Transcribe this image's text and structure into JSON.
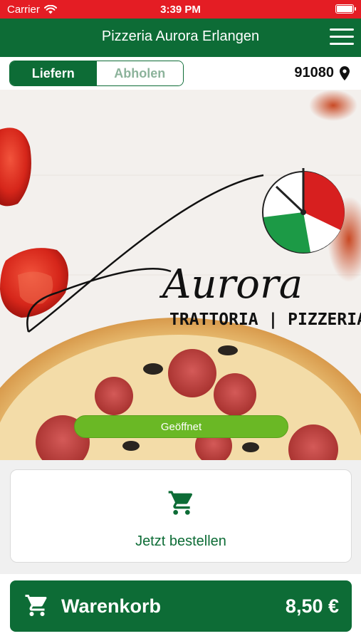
{
  "status_bar": {
    "carrier": "Carrier",
    "time": "3:39 PM",
    "battery_level": 1.0
  },
  "nav": {
    "title": "Pizzeria Aurora Erlangen",
    "menu_icon": "hamburger-menu-icon"
  },
  "order_mode": {
    "options": [
      "Liefern",
      "Abholen"
    ],
    "selected": "Liefern"
  },
  "location": {
    "zip": "91080",
    "icon": "location-pin-icon"
  },
  "hero": {
    "logo_script": "Aurora",
    "logo_tagline": "TRATTORIA | PIZZERIA",
    "status_badge": "Geöffnet"
  },
  "order_card": {
    "label": "Jetzt bestellen",
    "icon": "cart-icon"
  },
  "cart": {
    "label": "Warenkorb",
    "total": "8,50 €",
    "icon": "cart-icon"
  },
  "colors": {
    "primary": "#0d6c36",
    "status_bar": "#e41d24",
    "open_badge": "#6ab825"
  }
}
